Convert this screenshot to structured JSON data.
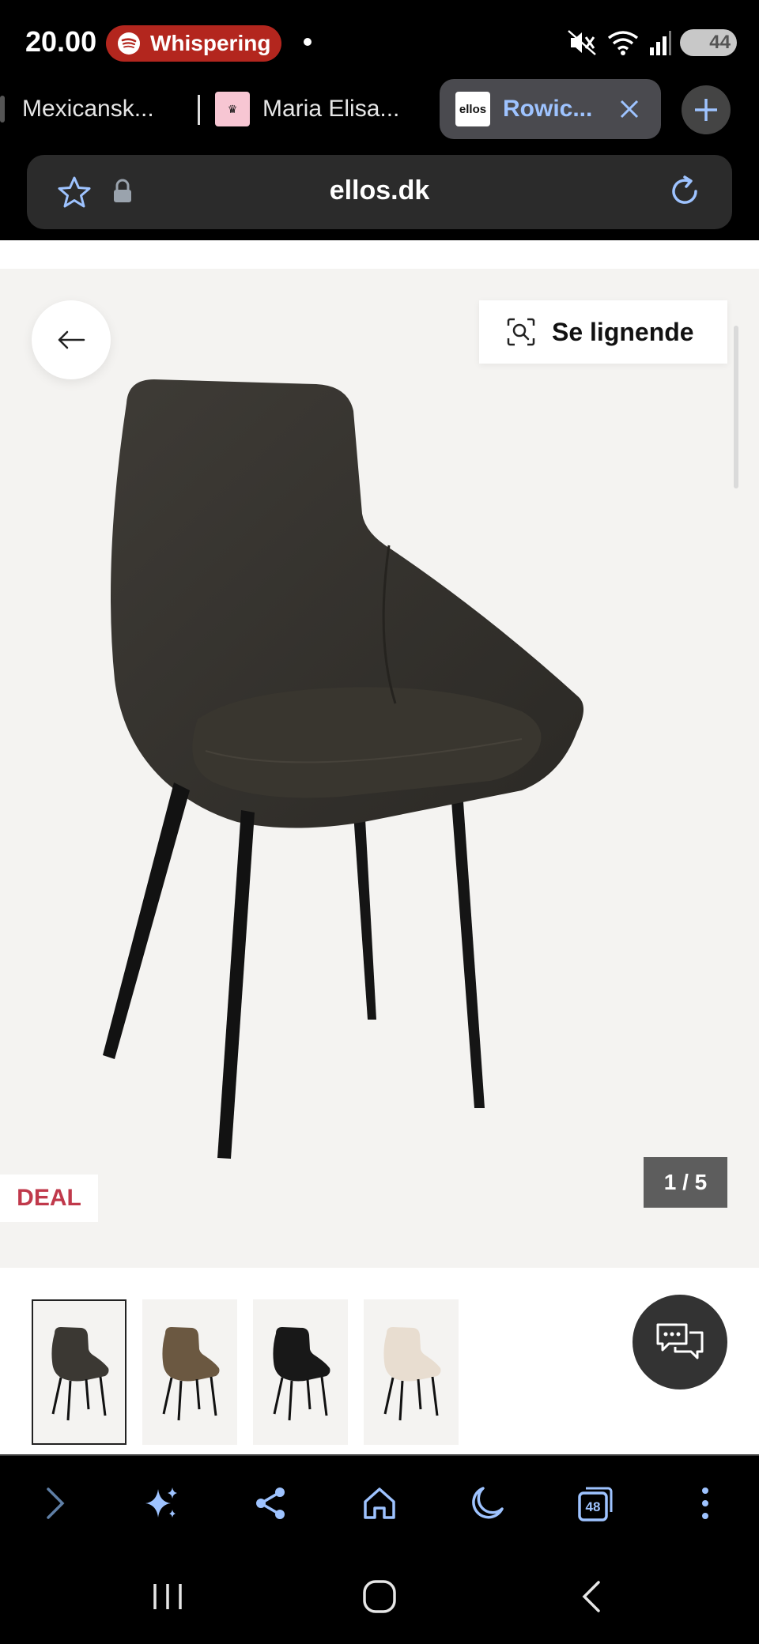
{
  "status_bar": {
    "time": "20.00",
    "now_playing": "Whispering",
    "battery": "44"
  },
  "tabs": [
    {
      "title": "Mexicansk..."
    },
    {
      "title": "Maria Elisa..."
    },
    {
      "title": "Rowic...",
      "favicon_text": "ellos",
      "active": true
    }
  ],
  "url_bar": {
    "domain": "ellos.dk"
  },
  "product": {
    "similar_label": "Se lignende",
    "badge": "DEAL",
    "image_counter": "1 / 5",
    "thumbnails": [
      {
        "name": "dark-grey-chair",
        "color": "#3b3833"
      },
      {
        "name": "brown-chair",
        "color": "#6b5841"
      },
      {
        "name": "black-chair",
        "color": "#181818"
      },
      {
        "name": "beige-chair",
        "color": "#e8ddd0"
      }
    ]
  },
  "toolbar": {
    "tab_count": "48"
  },
  "colors": {
    "accent": "#9ec3ff",
    "spotify_pill": "#b3261e",
    "deal": "#c0394b",
    "hero_bg": "#f4f3f1"
  }
}
